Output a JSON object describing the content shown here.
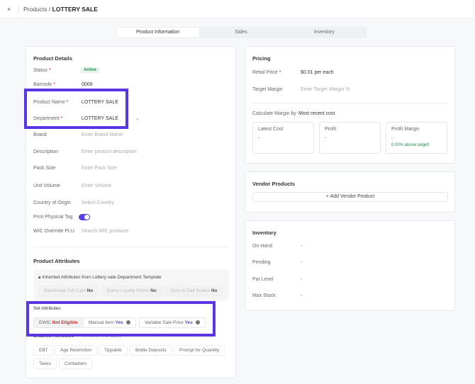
{
  "header": {
    "close": "×",
    "breadcrumb_parent": "Products",
    "breadcrumb_sep": "/",
    "breadcrumb_current": "LOTTERY SALE"
  },
  "tabs": [
    {
      "label": "Product Information",
      "active": true
    },
    {
      "label": "Sales"
    },
    {
      "label": "Inventory"
    }
  ],
  "details": {
    "title": "Product Details",
    "status_label": "Status",
    "status_value": "Active",
    "barcode_label": "Barcode",
    "barcode_value": "0009",
    "name_label": "Product Name",
    "name_value": "LOTTERY SALE",
    "dept_label": "Department",
    "dept_value": "LOTTERY SALE",
    "brand_label": "Brand",
    "brand_ph": "Enter Brand Name",
    "desc_label": "Description",
    "desc_ph": "Enter product description",
    "pack_label": "Pack Size",
    "pack_ph": "Enter Pack Size",
    "vol_label": "Unit Volume",
    "vol_ph": "Enter Volume",
    "country_label": "Country of Origin",
    "country_ph": "Select Country",
    "tag_label": "Print Physical Tag",
    "tag_on": true,
    "wic_label": "WIC Override PLU",
    "wic_ph": "Search WIC products"
  },
  "attributes": {
    "title": "Product Attributes",
    "inherited_title": "Inherited Attributes from Lottery sale Department Template",
    "inherited": [
      {
        "name": "Blackhawk Gift Card",
        "value": "No"
      },
      {
        "name": "Earns Loyalty Points",
        "value": "No"
      },
      {
        "name": "Sync to Deli Scales",
        "value": "No"
      }
    ],
    "set_title": "Set Attributes",
    "set": [
      {
        "name": "EWIC",
        "value": "Not Eligible"
      },
      {
        "name": "Manual Item",
        "value": "Yes"
      },
      {
        "name": "Variable Sale Price",
        "value": "Yes"
      }
    ],
    "enabled_title": "Enabled Attributes",
    "enabled_hint": "Select all that apply",
    "enabled": [
      "EBT",
      "Age Restriction",
      "Tippable",
      "Bottle Deposits",
      "Prompt for Quantity",
      "Taxes",
      "Containers"
    ]
  },
  "pricing": {
    "title": "Pricing",
    "retail_label": "Retail Price",
    "retail_value": "$0.01 per each",
    "target_label": "Target Margin",
    "target_ph": "Enter Target Margin %",
    "calc_label": "Calculate Margin by",
    "calc_value": "Most recent cost",
    "latest_label": "Latest Cost",
    "latest_value": "-",
    "profit_label": "Profit",
    "profit_value": "-",
    "margin_label": "Profit Margin",
    "margin_value": "-",
    "margin_note": "0.00% above target!"
  },
  "vendor": {
    "title": "Vendor Products",
    "add": "Add Vendor Product"
  },
  "inventory": {
    "title": "Inventory",
    "rows": [
      {
        "label": "On Hand",
        "value": "-"
      },
      {
        "label": "Pending",
        "value": "-"
      },
      {
        "label": "Par Level",
        "value": "-"
      },
      {
        "label": "Max Stock",
        "value": "-"
      }
    ]
  },
  "colors": {
    "accent": "#5a35e6",
    "active_green": "#2a8a4f",
    "error_red": "#d22222"
  }
}
